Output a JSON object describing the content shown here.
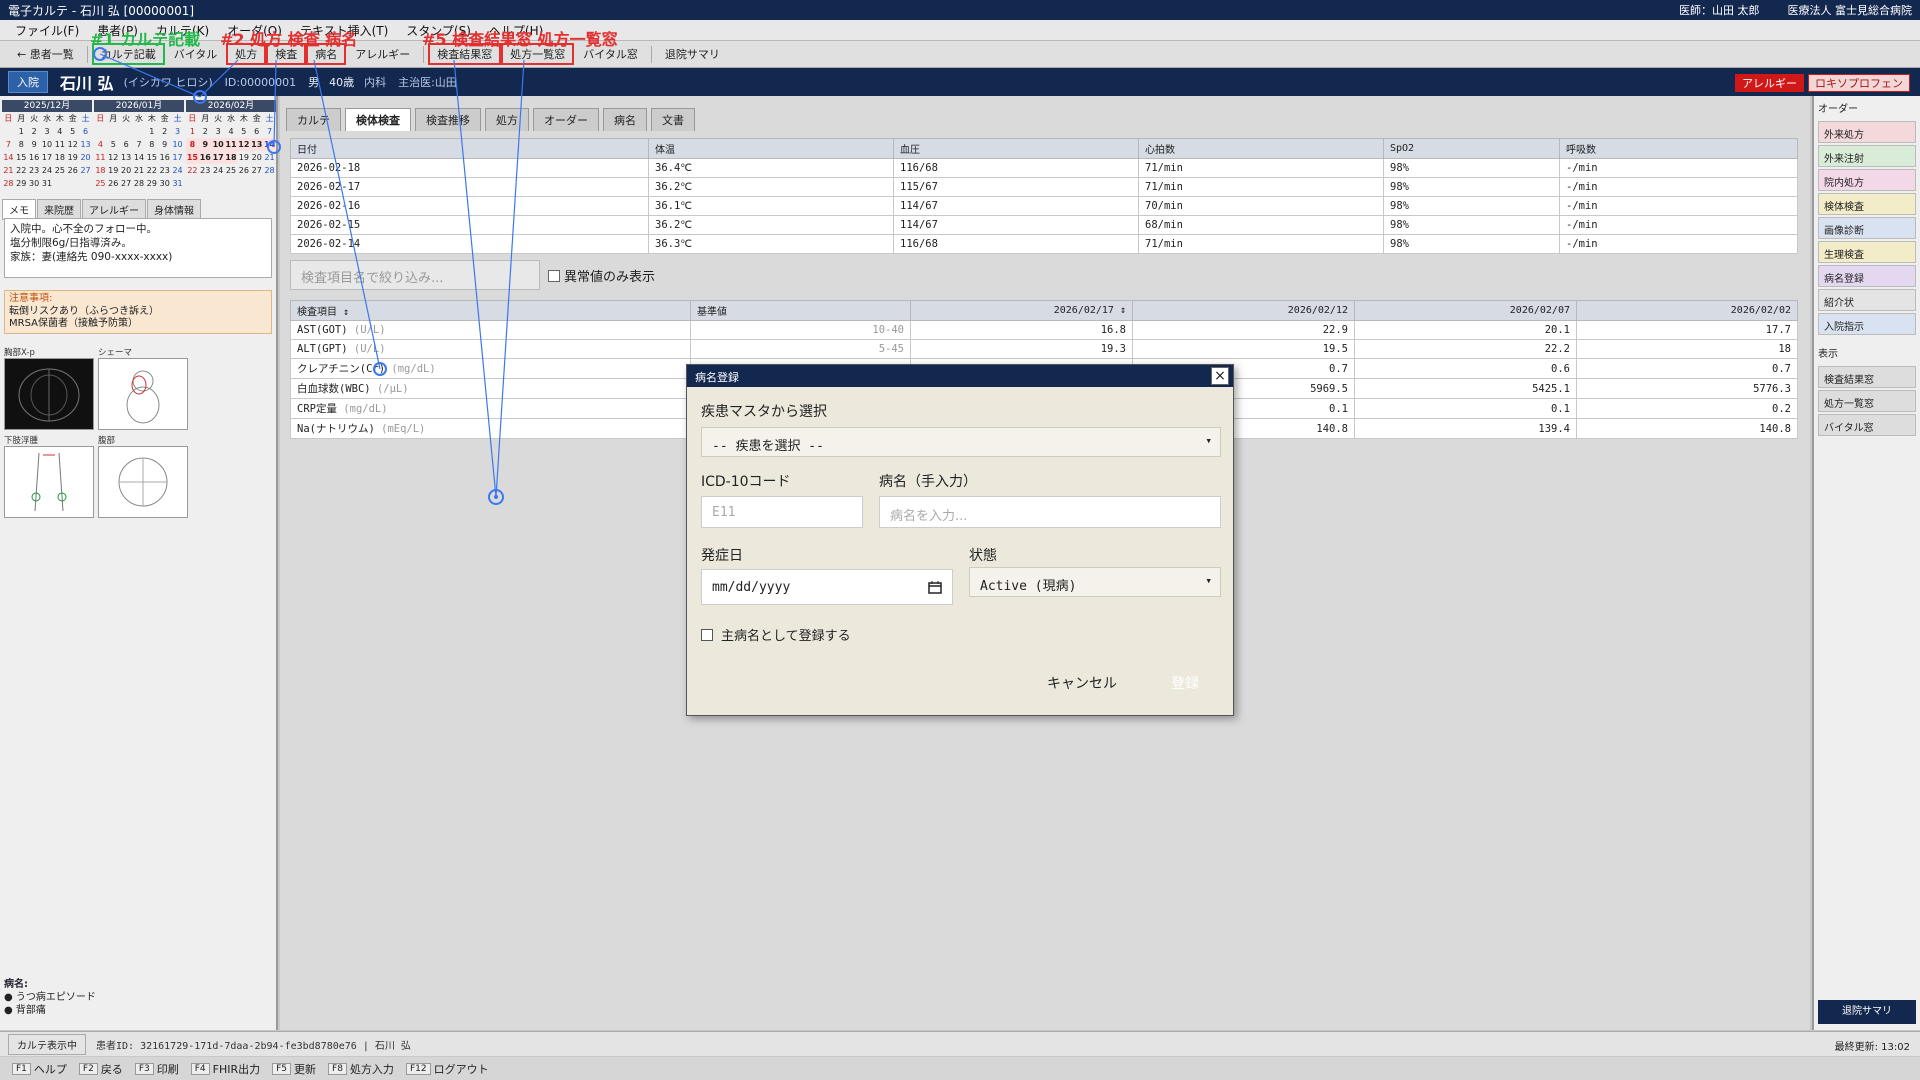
{
  "window": {
    "title": "電子カルテ - 石川 弘 [00000001]",
    "doctor": "医師：山田 太郎",
    "hospital": "医療法人 富士見総合病院"
  },
  "menu": [
    "ファイル(F)",
    "患者(P)",
    "カルテ(K)",
    "オーダ(O)",
    "テキスト挿入(T)",
    "スタンプ(S)",
    "ヘルプ(H)"
  ],
  "toolbar": {
    "back": "← 患者一覧",
    "chart": "カルテ記載",
    "vital": "バイタル",
    "rx": "処方",
    "lab": "検査",
    "dx": "病名",
    "allergy": "アレルギー",
    "labresult": "検査結果窓",
    "rxlist": "処方一覧窓",
    "vitalwin": "バイタル窓",
    "discharge": "退院サマリ"
  },
  "overlay": {
    "label1": "#1 カルテ記載",
    "label2": "#2 処方 検査 病名",
    "label5": "#5 検査結果窓 処方一覧窓"
  },
  "patient": {
    "status": "入院",
    "name": "石川 弘",
    "kana": "(イシカワ ヒロシ)",
    "id": "ID:00000001",
    "sex": "男",
    "age": "40歳",
    "dept": "内科",
    "attending": "主治医:山田",
    "allergy_tag": "アレルギー",
    "allergy_drug": "ロキソプロフェン"
  },
  "calendars": [
    {
      "title": "2025/12月",
      "days": [
        "日",
        "月",
        "火",
        "水",
        "木",
        "金",
        "土",
        "",
        "1",
        "2",
        "3",
        "4",
        "5",
        "6",
        "7",
        "8",
        "9",
        "10",
        "11",
        "12",
        "13",
        "14",
        "15",
        "16",
        "17",
        "18",
        "19",
        "20",
        "21",
        "22",
        "23",
        "24",
        "25",
        "26",
        "27",
        "28",
        "29",
        "30",
        "31"
      ]
    },
    {
      "title": "2026/01月",
      "days": [
        "日",
        "月",
        "火",
        "水",
        "木",
        "金",
        "土",
        "",
        "",
        "",
        "",
        "1",
        "2",
        "3",
        "4",
        "5",
        "6",
        "7",
        "8",
        "9",
        "10",
        "11",
        "12",
        "13",
        "14",
        "15",
        "16",
        "17",
        "18",
        "19",
        "20",
        "21",
        "22",
        "23",
        "24",
        "25",
        "26",
        "27",
        "28",
        "29",
        "30",
        "31"
      ]
    },
    {
      "title": "2026/02月",
      "days": [
        "日",
        "月",
        "火",
        "水",
        "木",
        "金",
        "土",
        "1",
        "2",
        "3",
        "4",
        "5",
        "6",
        "7",
        "8",
        "9",
        "10",
        "11",
        "12",
        "13",
        "14",
        "15",
        "16",
        "17",
        "18",
        "19",
        "20",
        "21",
        "22",
        "23",
        "24",
        "25",
        "26",
        "27",
        "28"
      ]
    }
  ],
  "left_tabs": [
    "メモ",
    "来院歴",
    "アレルギー",
    "身体情報"
  ],
  "memo": [
    "入院中。心不全のフォロー中。",
    "塩分制限6g/日指導済み。",
    "家族：妻(連絡先 090-xxxx-xxxx)"
  ],
  "caution": {
    "title": "注意事項:",
    "lines": [
      "転倒リスクあり（ふらつき訴え）",
      "MRSA保菌者（接触予防策）"
    ]
  },
  "images": {
    "xray": "胸部X-p",
    "schema": "シェーマ",
    "leg": "下肢浮腫",
    "abdomen": "腹部"
  },
  "diagnoses": {
    "title": "病名:",
    "items": [
      "うつ病エピソード",
      "背部痛"
    ]
  },
  "main_tabs": [
    "カルテ",
    "検体検査",
    "検査推移",
    "処方",
    "オーダー",
    "病名",
    "文書"
  ],
  "vitals": {
    "headers": [
      "日付",
      "体温",
      "血圧",
      "心拍数",
      "SpO2",
      "呼吸数"
    ],
    "rows": [
      [
        "2026-02-18",
        "36.4℃",
        "116/68",
        "71/min",
        "98%",
        "-/min"
      ],
      [
        "2026-02-17",
        "36.2℃",
        "115/67",
        "71/min",
        "98%",
        "-/min"
      ],
      [
        "2026-02-16",
        "36.1℃",
        "114/67",
        "70/min",
        "98%",
        "-/min"
      ],
      [
        "2026-02-15",
        "36.2℃",
        "114/67",
        "68/min",
        "98%",
        "-/min"
      ],
      [
        "2026-02-14",
        "36.3℃",
        "116/68",
        "71/min",
        "98%",
        "-/min"
      ]
    ]
  },
  "filter": {
    "placeholder": "検査項目名で絞り込み...",
    "abnormal_only": "異常値のみ表示"
  },
  "labs": {
    "headers": [
      "検査項目 ↕",
      "基準値",
      "2026/02/17 ↕",
      "2026/02/12",
      "2026/02/07",
      "2026/02/02"
    ],
    "rows": [
      {
        "name": "AST(GOT)",
        "unit": "(U/L)",
        "ref": "10-40",
        "v": [
          "16.8",
          "22.9",
          "20.1",
          "17.7"
        ]
      },
      {
        "name": "ALT(GPT)",
        "unit": "(U/L)",
        "ref": "5-45",
        "v": [
          "19.3",
          "19.5",
          "22.2",
          "18"
        ]
      },
      {
        "name": "クレアチニン(Cr)",
        "unit": "(mg/dL)",
        "ref": "",
        "v": [
          "",
          "0.7",
          "0.6",
          "0.7"
        ]
      },
      {
        "name": "白血球数(WBC)",
        "unit": "(/μL)",
        "ref": "",
        "v": [
          "",
          "5969.5",
          "5425.1",
          "5776.3"
        ]
      },
      {
        "name": "CRP定量",
        "unit": "(mg/dL)",
        "ref": "",
        "v": [
          "",
          "0.1",
          "0.1",
          "0.2"
        ]
      },
      {
        "name": "Na(ナトリウム)",
        "unit": "(mEq/L)",
        "ref": "",
        "v": [
          "",
          "140.8",
          "139.4",
          "140.8"
        ]
      }
    ]
  },
  "right": {
    "order_title": "オーダー",
    "orders": [
      "外来処方",
      "外来注射",
      "院内処方",
      "検体検査",
      "画像診断",
      "生理検査",
      "病名登録",
      "紹介状",
      "入院指示"
    ],
    "view_title": "表示",
    "views": [
      "検査結果窓",
      "処方一覧窓",
      "バイタル窓"
    ],
    "summary": "退院サマリ"
  },
  "status": {
    "mode": "カルテ表示中",
    "patient_ref": "患者ID: 32161729-171d-7daa-2b94-fe3bd8780e76 | 石川 弘",
    "updated": "最終更新: 13:02"
  },
  "fkeys": [
    [
      "F1",
      "ヘルプ"
    ],
    [
      "F2",
      "戻る"
    ],
    [
      "F3",
      "印刷"
    ],
    [
      "F4",
      "FHIR出力"
    ],
    [
      "F5",
      "更新"
    ],
    [
      "F8",
      "処方入力"
    ],
    [
      "F12",
      "ログアウト"
    ]
  ],
  "modal": {
    "title": "病名登録",
    "master_label": "疾患マスタから選択",
    "master_value": "-- 疾患を選択 --",
    "icd_label": "ICD-10コード",
    "icd_placeholder": "E11",
    "name_label": "病名（手入力）",
    "name_placeholder": "病名を入力...",
    "onset_label": "発症日",
    "onset_placeholder": "mm/dd/yyyy",
    "state_label": "状態",
    "state_value": "Active (現病)",
    "primary_label": "主病名として登録する",
    "cancel": "キャンセル",
    "register": "登録"
  },
  "colors": {
    "navy": "#13284f",
    "accent_red": "#e23030",
    "accent_green": "#22b84a",
    "accent_blue": "#3a78f0"
  }
}
